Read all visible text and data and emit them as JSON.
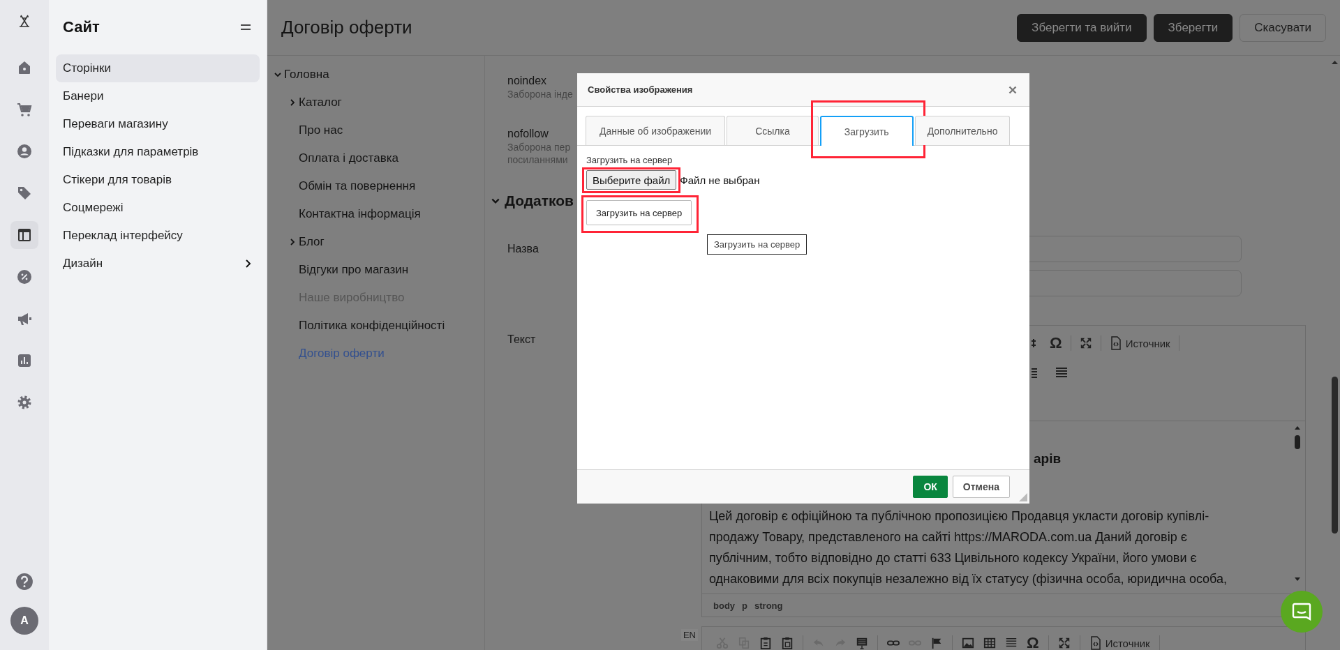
{
  "rail": {
    "items": [
      {
        "selected": false
      },
      {
        "selected": false
      },
      {
        "selected": false
      },
      {
        "selected": false
      },
      {
        "selected": true
      },
      {
        "selected": false
      },
      {
        "selected": false
      },
      {
        "selected": false
      },
      {
        "selected": false
      }
    ],
    "avatar": "A"
  },
  "sidebar": {
    "title": "Сайт",
    "items": [
      {
        "label": "Сторінки",
        "selected": true,
        "has_submenu": false
      },
      {
        "label": "Банери",
        "selected": false,
        "has_submenu": false
      },
      {
        "label": "Переваги магазину",
        "selected": false,
        "has_submenu": false
      },
      {
        "label": "Підказки для параметрів",
        "selected": false,
        "has_submenu": false
      },
      {
        "label": "Стікери для товарів",
        "selected": false,
        "has_submenu": false
      },
      {
        "label": "Соцмережі",
        "selected": false,
        "has_submenu": false
      },
      {
        "label": "Переклад інтерфейсу",
        "selected": false,
        "has_submenu": false
      },
      {
        "label": "Дизайн",
        "selected": false,
        "has_submenu": true
      }
    ]
  },
  "page": {
    "title": "Договір оферти",
    "actions": [
      {
        "label": "Зберегти та вийти",
        "kind": "primary"
      },
      {
        "label": "Зберегти",
        "kind": "primary"
      },
      {
        "label": "Скасувати",
        "kind": "secondary"
      }
    ]
  },
  "tree": [
    {
      "label": "Головна",
      "kind": "branch",
      "expanded": true,
      "selected": false,
      "muted": false,
      "children": [
        {
          "label": "Каталог",
          "kind": "branch",
          "expanded": false,
          "selected": false,
          "muted": false
        },
        {
          "label": "Про нас",
          "kind": "leaf",
          "selected": false,
          "muted": false
        },
        {
          "label": "Оплата і доставка",
          "kind": "leaf",
          "selected": false,
          "muted": false
        },
        {
          "label": "Обмін та повернення",
          "kind": "leaf",
          "selected": false,
          "muted": false
        },
        {
          "label": "Контактна інформація",
          "kind": "leaf",
          "selected": false,
          "muted": false
        },
        {
          "label": "Блог",
          "kind": "branch",
          "expanded": false,
          "selected": false,
          "muted": false
        },
        {
          "label": "Відгуки про магазин",
          "kind": "leaf",
          "selected": false,
          "muted": false
        },
        {
          "label": "Наше виробництво",
          "kind": "leaf",
          "selected": false,
          "muted": true
        },
        {
          "label": "Політика конфіденційності",
          "kind": "leaf",
          "selected": false,
          "muted": false
        },
        {
          "label": "Договір оферти",
          "kind": "leaf",
          "selected": true,
          "muted": false
        }
      ]
    }
  ],
  "form": {
    "robots": [
      {
        "label": "noindex",
        "hint_lines": [
          "Заборона інде"
        ]
      },
      {
        "label": "nofollow",
        "hint_lines": [
          "Заборона пер",
          "посиланнями"
        ]
      }
    ],
    "section": {
      "title": "Додатков",
      "expanded": true
    },
    "name_label": "Назва",
    "text_label": "Текст",
    "editor": {
      "symbol": "Ω",
      "source_label": "Источник",
      "heading": "арів",
      "paragraph_lines": [
        "Цей договір є офіційною та публічною пропозицією Продавця укласти договір купівлі-",
        "продажу Товару, представленого на сайті https://MARODA.com.ua Даний договір є",
        "публічним, тобто відповідно до статті 633 Цивільного кодексу України, його умови є",
        "однаковими для всіх покупців незалежно від їх статусу (фізична особа, юридична особа,"
      ],
      "path": [
        "body",
        "p",
        "strong"
      ]
    },
    "editor2": {
      "language": "EN",
      "symbol": "Ω",
      "source_label": "Источник"
    }
  },
  "dialog": {
    "title": "Свойства изображения",
    "tabs": [
      {
        "label": "Данные об изображении",
        "selected": false,
        "highlighted": false
      },
      {
        "label": "Ссылка",
        "selected": false,
        "highlighted": false
      },
      {
        "label": "Загрузить",
        "selected": true,
        "highlighted": true
      },
      {
        "label": "Дополнительно",
        "selected": false,
        "highlighted": false
      }
    ],
    "upload_label": "Загрузить на сервер",
    "file_button": {
      "label": "Выберите файл",
      "highlighted": true
    },
    "file_status": "Файл не выбран",
    "upload_button": {
      "label": "Загрузить на сервер",
      "highlighted": true
    },
    "tooltip": "Загрузить на сервер",
    "ok": "ОК",
    "cancel": "Отмена"
  }
}
